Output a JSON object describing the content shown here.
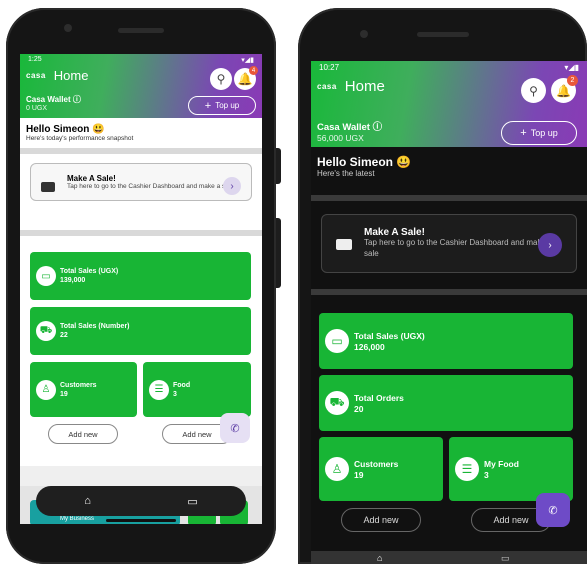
{
  "light": {
    "status_time": "1:25",
    "status_icons": "▾◢▮",
    "logo": "casa",
    "title": "Home",
    "notif_count": "4",
    "wallet_label": "Casa Wallet ⓘ",
    "wallet_amount": "0 UGX",
    "topup_label": "Top up",
    "greeting": "Hello Simeon 😃",
    "greeting_sub": "Here's today's performance snapshot",
    "sale_title": "Make A Sale!",
    "sale_desc": "Tap here to go to the Cashier Dashboard and make a sale",
    "cards": [
      {
        "label": "Total Sales (UGX)",
        "value": "139,000",
        "icon": "cash-icon"
      },
      {
        "label": "Total Sales (Number)",
        "value": "22",
        "icon": "truck-icon"
      },
      {
        "label": "Customers",
        "value": "19",
        "icon": "person-icon"
      },
      {
        "label": "Food",
        "value": "3",
        "icon": "burger-icon"
      }
    ],
    "add_new": "Add new",
    "peek_text": "My Business"
  },
  "dark": {
    "status_time": "10:27",
    "status_icons": "▾◢▮",
    "logo": "casa",
    "title": "Home",
    "notif_count": "2",
    "wallet_label": "Casa Wallet ⓘ",
    "wallet_amount": "56,000 UGX",
    "topup_label": "Top up",
    "greeting": "Hello Simeon 😃",
    "greeting_sub": "Here's the latest",
    "sale_title": "Make A Sale!",
    "sale_desc": "Tap here to go to the Cashier Dashboard and make a sale",
    "cards": [
      {
        "label": "Total Sales (UGX)",
        "value": "126,000",
        "icon": "cash-icon"
      },
      {
        "label": "Total Orders",
        "value": "20",
        "icon": "truck-icon"
      },
      {
        "label": "Customers",
        "value": "19",
        "icon": "person-icon"
      },
      {
        "label": "My Food",
        "value": "3",
        "icon": "burger-icon"
      }
    ],
    "add_new": "Add new"
  },
  "colors": {
    "green": "#18b535",
    "purple": "#6e4bc7"
  }
}
